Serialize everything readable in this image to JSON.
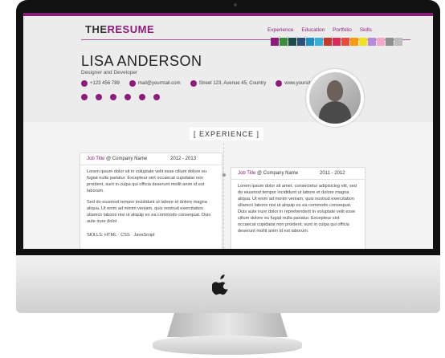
{
  "brand": {
    "part1": "THE",
    "part2": "RESUME"
  },
  "nav": [
    "Experience",
    "Education",
    "Portfolio",
    "Skills"
  ],
  "colors": {
    "accent": "#8b1d7a",
    "swatches": [
      "#8b1d7a",
      "#3c8c3c",
      "#1e4a4a",
      "#2e4f7a",
      "#1d8fc1",
      "#3ab0d6",
      "#c0392b",
      "#d62d5a",
      "#e74c3c",
      "#f39c12",
      "#f1e21f",
      "#b58ad6",
      "#f4a9c8",
      "#8e8e8e",
      "#bdbdbd"
    ]
  },
  "profile": {
    "name": "LISA ANDERSON",
    "role": "Designer and Developer",
    "phone": "+123 456 789",
    "email": "mail@yourmail.com",
    "address": "Street 123, Avenue 45, Country",
    "website": "www.yoursite.com",
    "socials": [
      "globe-icon",
      "facebook-icon",
      "twitter-icon",
      "linkedin-icon",
      "flickr-icon",
      "skype-icon"
    ]
  },
  "section": {
    "experience_title": "[ EXPERIENCE ]"
  },
  "jobs": [
    {
      "title": "Job Title",
      "at": "@ Company Name",
      "years": "2012 - 2013",
      "p1": "Lorem ipsum dolor sit in voluptate velit esse cillum dolore eu fugiat nulla pariatur. Excepteur sint occaecat cupidatat non proident, sunt in culpa qui officia deserunt mollit anim id est laborum.",
      "p2": "Sed do eiusmod tempor incididunt ut labore et dolore magna aliqua. Ut enim ad minim veniam, quis nostrud exercitation ullamco laboris nisi ut aliquip ex ea commodo consequat. Duis aute irure dolor",
      "skills": "SKILLS: HTML · CSS · JavaScript"
    },
    {
      "title": "Job Title",
      "at": "@ Company Name",
      "years": "2011 - 2012",
      "p1": "Lorem ipsum dolor sit amet, consectetur adipisicing elit, sed do eiusmod tempor incididunt ut labore et dolore magna aliqua. Ut enim ad minim veniam, quis nostrud exercitation ullamco laboris nisi ut aliquip ex ea commodo consequat. Duis aute irure dolor in reprehenderit in voluptate velit esse cillum dolore eu fugiat nulla pariatur. Excepteur sint occaecat cupidatat non proident, sunt in culpa qui officia deserunt mollit anim id est laborum."
    }
  ]
}
